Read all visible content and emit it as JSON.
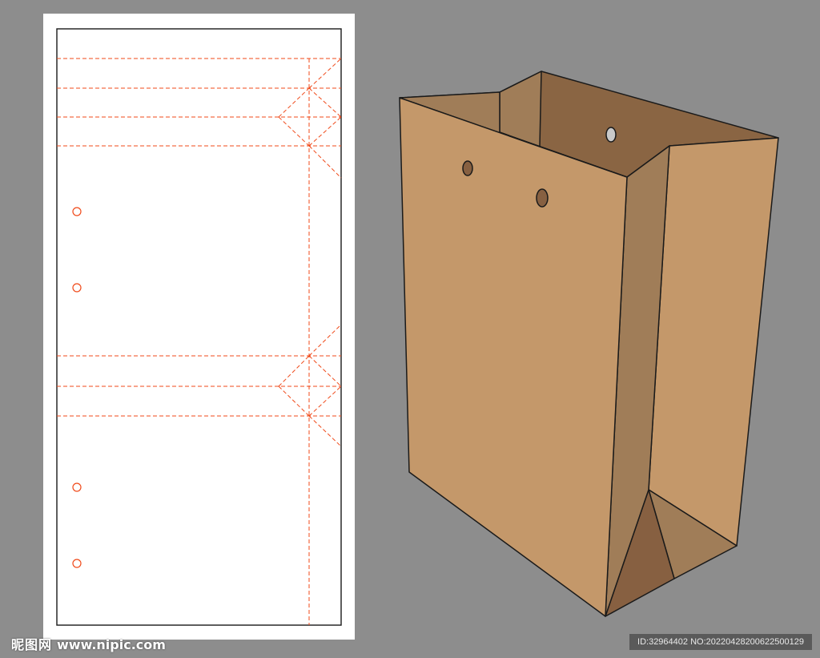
{
  "colors": {
    "background": "#8d8d8d",
    "artboard": "#ffffff",
    "cut_line": "#000000",
    "fold_line": "#f04a1a",
    "bag_front": "#c4986a",
    "bag_side_inner": "#a07d58",
    "bag_back_inner": "#8a6543",
    "bag_gusset_dark": "#876041",
    "outline": "#1a1a1a"
  },
  "watermark": {
    "site_name": "昵图网",
    "site_url": "www.nipic.com",
    "id_text": "ID:32964402 NO:20220428200622500129"
  }
}
